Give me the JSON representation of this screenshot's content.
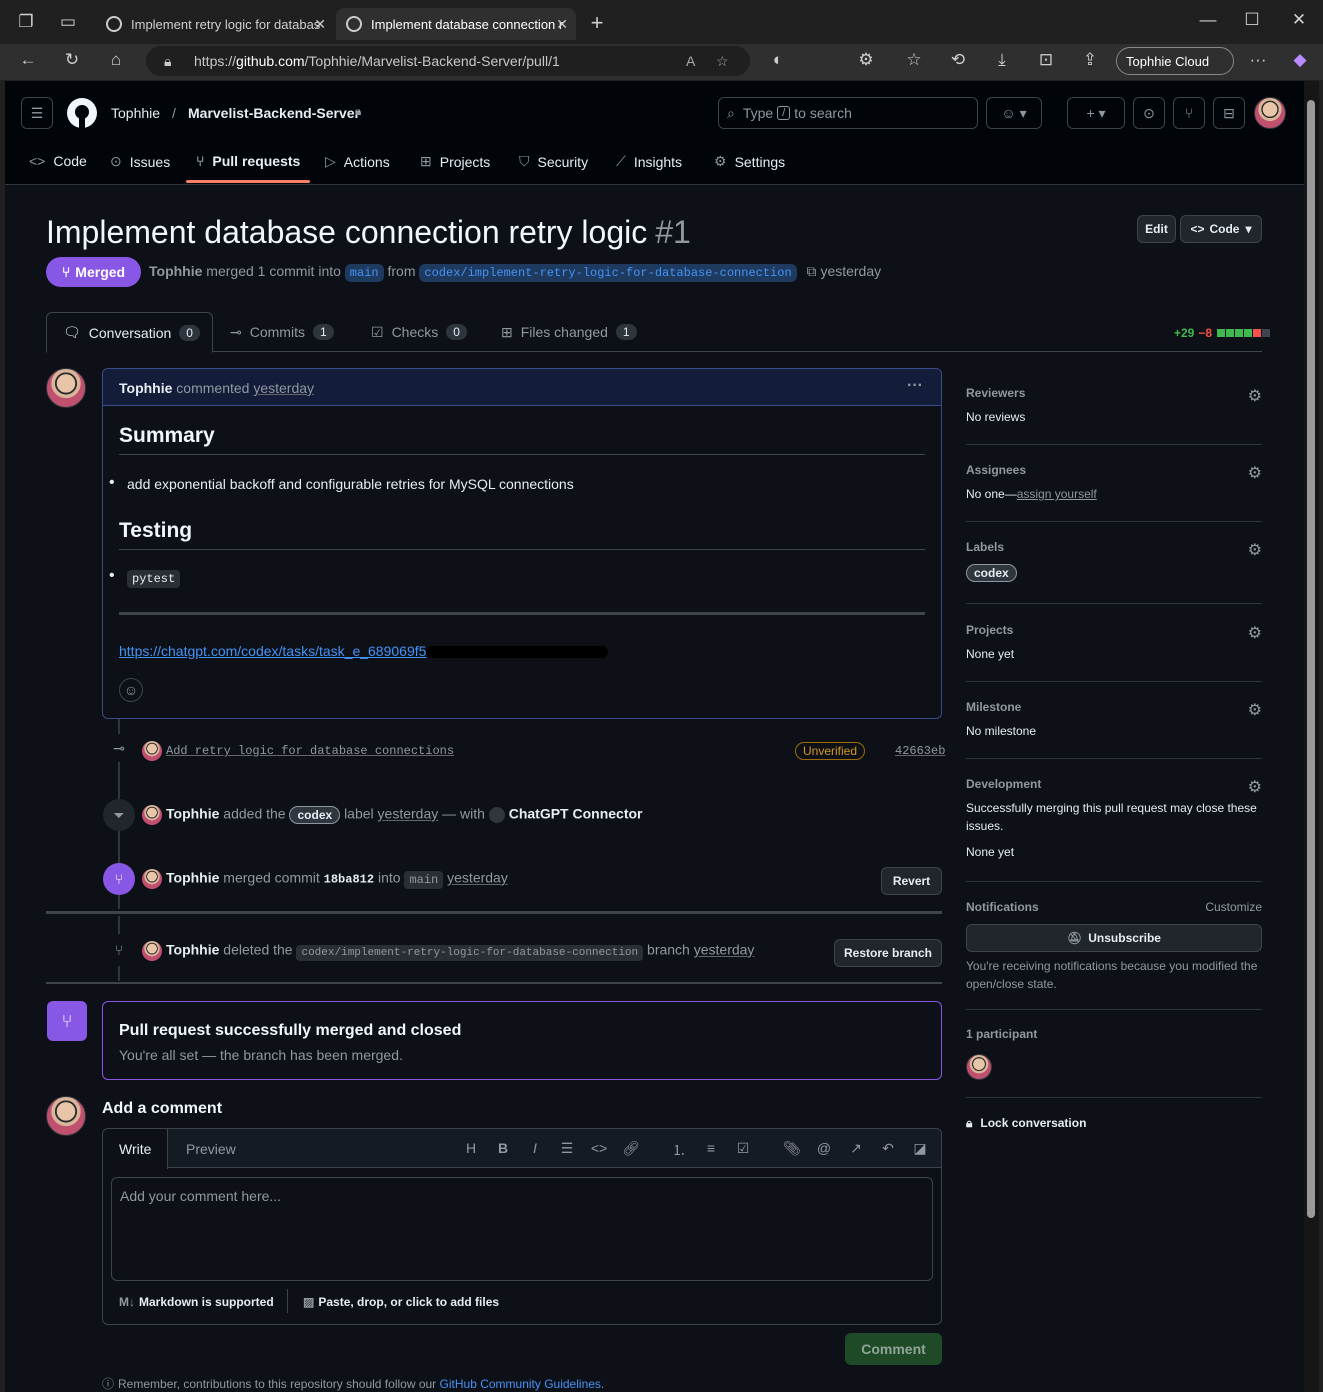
{
  "browser": {
    "tabs": [
      {
        "title": "Implement retry logic for databas"
      },
      {
        "title": "Implement database connection r"
      }
    ],
    "url_prefix": "https://",
    "url_host": "github.com",
    "url_path": "/Tophhie/Marvelist-Backend-Server/pull/1",
    "profile": "Tophhie Cloud"
  },
  "header": {
    "owner": "Tophhie",
    "separator": "/",
    "repo": "Marvelist-Backend-Server",
    "search_placeholder_pre": "Type",
    "search_key": "/",
    "search_placeholder_post": "to search"
  },
  "repo_nav": [
    {
      "label": "Code",
      "icon": "code-icon"
    },
    {
      "label": "Issues",
      "icon": "issue-icon"
    },
    {
      "label": "Pull requests",
      "icon": "pull-request-icon"
    },
    {
      "label": "Actions",
      "icon": "play-icon"
    },
    {
      "label": "Projects",
      "icon": "table-icon"
    },
    {
      "label": "Security",
      "icon": "shield-icon"
    },
    {
      "label": "Insights",
      "icon": "graph-icon"
    },
    {
      "label": "Settings",
      "icon": "gear-icon"
    }
  ],
  "pr": {
    "title": "Implement database connection retry logic",
    "number": "#1",
    "edit_label": "Edit",
    "code_label": "Code",
    "state": "Merged",
    "author": "Tophhie",
    "merge_text": "merged 1 commit into",
    "base": "main",
    "from_text": "from",
    "head": "codex/implement-retry-logic-for-database-connection",
    "time": "yesterday"
  },
  "pr_tabs": [
    {
      "label": "Conversation",
      "count": "0"
    },
    {
      "label": "Commits",
      "count": "1"
    },
    {
      "label": "Checks",
      "count": "0"
    },
    {
      "label": "Files changed",
      "count": "1"
    }
  ],
  "diffstat": {
    "additions": "+29",
    "deletions": "−8",
    "colors": [
      "#3fb950",
      "#3fb950",
      "#3fb950",
      "#3fb950",
      "#f85149",
      "#3d444d"
    ]
  },
  "comment": {
    "author": "Tophhie",
    "action": "commented",
    "time": "yesterday",
    "menu": "···",
    "h_summary": "Summary",
    "summary_item": "add exponential backoff and configurable retries for MySQL connections",
    "h_testing": "Testing",
    "testing_item": "pytest",
    "link": "https://chatgpt.com/codex/tasks/task_e_689069f5"
  },
  "timeline": {
    "commit_message": "Add retry logic for database connections",
    "commit_badge": "Unverified",
    "commit_sha": "42663eb",
    "label_event": {
      "actor": "Tophhie",
      "pre": "added the",
      "label": "codex",
      "post": "label",
      "time": "yesterday",
      "with": "— with",
      "app": "ChatGPT Connector"
    },
    "merge_event": {
      "actor": "Tophhie",
      "pre": "merged commit",
      "sha": "18ba812",
      "into": "into",
      "branch": "main",
      "time": "yesterday",
      "button": "Revert"
    },
    "delete_event": {
      "actor": "Tophhie",
      "pre": "deleted the",
      "branch": "codex/implement-retry-logic-for-database-connection",
      "post": "branch",
      "time": "yesterday",
      "button": "Restore branch"
    }
  },
  "merged_box": {
    "title": "Pull request successfully merged and closed",
    "subtitle": "You're all set — the branch has been merged."
  },
  "add_comment": {
    "heading": "Add a comment",
    "tab_write": "Write",
    "tab_preview": "Preview",
    "placeholder": "Add your comment here...",
    "markdown_note": "Markdown is supported",
    "files_note": "Paste, drop, or click to add files",
    "submit": "Comment",
    "footer_pre": "Remember, contributions to this repository should follow our",
    "footer_link": "GitHub Community Guidelines",
    "footer_post": "."
  },
  "sidebar": {
    "reviewers": {
      "label": "Reviewers",
      "value": "No reviews"
    },
    "assignees": {
      "label": "Assignees",
      "value": "No one—",
      "link": "assign yourself"
    },
    "labels": {
      "label": "Labels",
      "value": "codex"
    },
    "projects": {
      "label": "Projects",
      "value": "None yet"
    },
    "milestone": {
      "label": "Milestone",
      "value": "No milestone"
    },
    "development": {
      "label": "Development",
      "desc": "Successfully merging this pull request may close these issues.",
      "value": "None yet"
    },
    "notifications": {
      "label": "Notifications",
      "customize": "Customize",
      "button": "Unsubscribe",
      "desc": "You're receiving notifications because you modified the open/close state."
    },
    "participants": {
      "label": "1 participant"
    },
    "lock": "Lock conversation"
  }
}
